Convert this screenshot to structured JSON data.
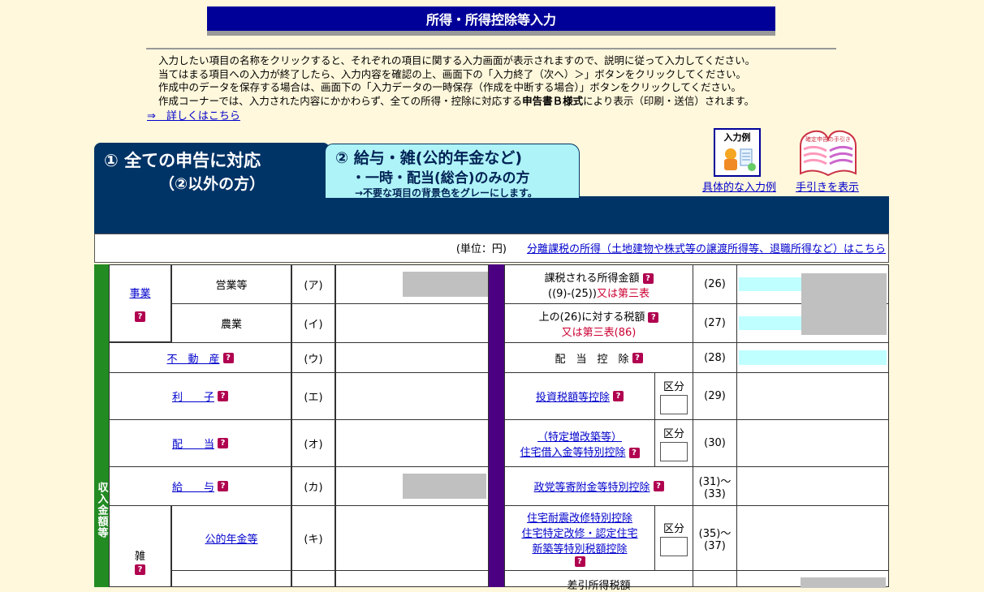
{
  "header": {
    "title": "所得・所得控除等入力",
    "instructions": [
      "入力したい項目の名称をクリックすると、それぞれの項目に関する入力画面が表示されますので、説明に従って入力してください。",
      "当てはまる項目への入力が終了したら、入力内容を確認の上、画面下の「入力終了（次へ）＞」ボタンをクリックしてください。",
      "作成中のデータを保存する場合は、画面下の「入力データの一時保存（作成を中断する場合）」ボタンをクリックしてください。"
    ],
    "instruction4_pre": "作成コーナーでは、入力された内容にかかわらず、全ての所得・控除に対応する",
    "instruction4_bold": "申告書Ｂ様式",
    "instruction4_post": "により表示（印刷・送信）されます。",
    "detail_link": "⇒　詳しくはこちら"
  },
  "tabs": {
    "tab1": {
      "line1": "①  全ての申告に対応",
      "line2": "（②以外の方）"
    },
    "tab2": {
      "line1": "②  給与・雑(公的年金など)",
      "line2": "・一時・配当(総合)のみの方",
      "line3": "→不要な項目の背景色をグレーにします。"
    }
  },
  "side_links": {
    "example_caption": "入力例",
    "example_label": "具体的な入力例",
    "guide_label": "手引きを表示",
    "guide_cover_text": "確定申告の手引き"
  },
  "unit_bar": {
    "unit": "(単位：円)",
    "separate_link": "分離課税の所得（土地建物や株式等の譲渡所得等、退職所得など）はこちら"
  },
  "income": {
    "band_label": "収入金額等",
    "business_label": "事業",
    "eigyo_label": "営業等",
    "eigyo_code": "(ア)",
    "nogyo_label": "農業",
    "nogyo_code": "(イ)",
    "fudosan_label": "不　動　産",
    "fudosan_code": "(ウ)",
    "rishi_label": "利　　子",
    "rishi_code": "(エ)",
    "haito_label": "配　　当",
    "haito_code": "(オ)",
    "kyuyo_label": "給　　与",
    "kyuyo_code": "(カ)",
    "zatsu_label": "雑",
    "nenkin_label": "公的年金等",
    "nenkin_code": "(キ)"
  },
  "tax": {
    "r26_label": "課税される所得金額",
    "r26_sub": "((9)-(25))",
    "r26_red": "又は第三表",
    "r26_code": "(26)",
    "r27_label": "上の(26)に対する税額",
    "r27_red": "又は第三表(86)",
    "r27_code": "(27)",
    "r28_label": "配　当　控　除",
    "r28_code": "(28)",
    "r29_label": "投資税額等控除",
    "r29_code": "(29)",
    "r30_line1": "（特定増改築等）",
    "r30_line2": "住宅借入金等特別控除",
    "r30_code": "(30)",
    "r31_label": "政党等寄附金等特別控除",
    "r31_code_a": "(31)～",
    "r31_code_b": "(33)",
    "r35_line1": "住宅耐震改修特別控除",
    "r35_line2": "住宅特定改修・認定住宅",
    "r35_line3": "新築等特別税額控除",
    "r35_code_a": "(35)～",
    "r35_code_b": "(37)",
    "r38_label": "差引所得税額",
    "kubun": "区分"
  },
  "help_glyph": "?",
  "colors": {
    "title_bg": "#000099",
    "tab_bg": "#003366",
    "tab2_bg": "#aef3f7",
    "income_band": "#228b22",
    "divider_band": "#4b0082",
    "help_icon": "#b0004f"
  }
}
